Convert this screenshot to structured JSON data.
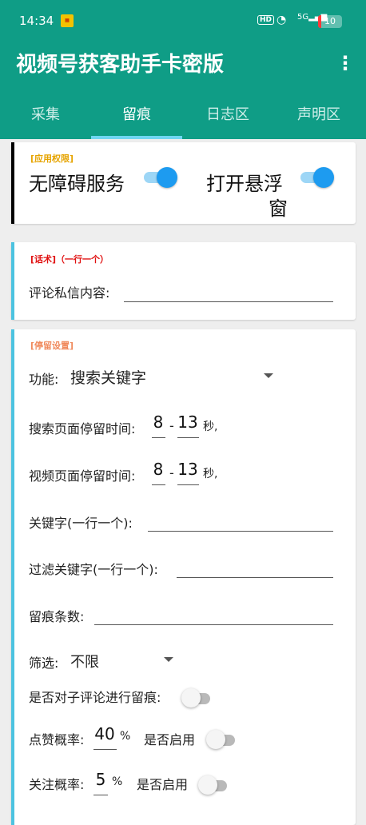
{
  "status": {
    "time": "14:34",
    "hd": "HD",
    "net": "5G",
    "battery": "10"
  },
  "app": {
    "title": "视频号获客助手卡密版",
    "more_icon": "more-vert-icon"
  },
  "tabs": [
    {
      "label": "采集",
      "active": false
    },
    {
      "label": "留痕",
      "active": true
    },
    {
      "label": "日志区",
      "active": false
    },
    {
      "label": "声明区",
      "active": false
    }
  ],
  "permissions": {
    "section_title": "[应用权限]",
    "accessibility_label": "无障碍服务",
    "accessibility_on": true,
    "overlay_label_line1": "打开悬浮",
    "overlay_label_line2": "窗",
    "overlay_on": true
  },
  "script": {
    "section_title": "[话术]（一行一个）",
    "comment_label": "评论私信内容:",
    "comment_value": ""
  },
  "stay": {
    "section_title": "[停留设置]",
    "function_label": "功能:",
    "function_value": "搜索关键字",
    "search_stay_label": "搜索页面停留时间:",
    "search_stay_min": "8",
    "search_stay_max": "13",
    "video_stay_label": "视频页面停留时间:",
    "video_stay_min": "8",
    "video_stay_max": "13",
    "dash": "-",
    "seconds_unit": "秒,",
    "keywords_label": "关键字(一行一个):",
    "keywords_value": "",
    "filter_keywords_label": "过滤关键字(一行一个):",
    "filter_keywords_value": "",
    "count_label": "留痕条数:",
    "count_value": "",
    "filter_label": "筛选:",
    "filter_value": "不限",
    "subcomment_label": "是否对子评论进行留痕:",
    "subcomment_on": false,
    "like_label": "点赞概率:",
    "like_value": "40",
    "percent": "%",
    "like_enable_label": "是否启用",
    "like_enable_on": false,
    "follow_label": "关注概率:",
    "follow_value": "5",
    "follow_enable_label": "是否启用",
    "follow_enable_on": false
  },
  "colors": {
    "primary": "#0f9d86",
    "accent": "#1d9bf0",
    "permission_title": "#e6a400",
    "script_title": "#e01010",
    "stay_title": "#f08a5d",
    "bar_black": "#000000",
    "bar_blue": "#4cc3e0"
  }
}
